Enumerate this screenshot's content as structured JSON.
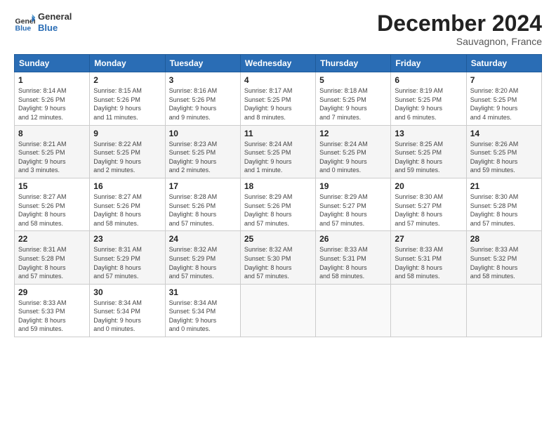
{
  "logo": {
    "line1": "General",
    "line2": "Blue"
  },
  "title": "December 2024",
  "subtitle": "Sauvagnon, France",
  "days_of_week": [
    "Sunday",
    "Monday",
    "Tuesday",
    "Wednesday",
    "Thursday",
    "Friday",
    "Saturday"
  ],
  "weeks": [
    [
      {
        "day": 1,
        "info": "Sunrise: 8:14 AM\nSunset: 5:26 PM\nDaylight: 9 hours\nand 12 minutes."
      },
      {
        "day": 2,
        "info": "Sunrise: 8:15 AM\nSunset: 5:26 PM\nDaylight: 9 hours\nand 11 minutes."
      },
      {
        "day": 3,
        "info": "Sunrise: 8:16 AM\nSunset: 5:26 PM\nDaylight: 9 hours\nand 9 minutes."
      },
      {
        "day": 4,
        "info": "Sunrise: 8:17 AM\nSunset: 5:25 PM\nDaylight: 9 hours\nand 8 minutes."
      },
      {
        "day": 5,
        "info": "Sunrise: 8:18 AM\nSunset: 5:25 PM\nDaylight: 9 hours\nand 7 minutes."
      },
      {
        "day": 6,
        "info": "Sunrise: 8:19 AM\nSunset: 5:25 PM\nDaylight: 9 hours\nand 6 minutes."
      },
      {
        "day": 7,
        "info": "Sunrise: 8:20 AM\nSunset: 5:25 PM\nDaylight: 9 hours\nand 4 minutes."
      }
    ],
    [
      {
        "day": 8,
        "info": "Sunrise: 8:21 AM\nSunset: 5:25 PM\nDaylight: 9 hours\nand 3 minutes."
      },
      {
        "day": 9,
        "info": "Sunrise: 8:22 AM\nSunset: 5:25 PM\nDaylight: 9 hours\nand 2 minutes."
      },
      {
        "day": 10,
        "info": "Sunrise: 8:23 AM\nSunset: 5:25 PM\nDaylight: 9 hours\nand 2 minutes."
      },
      {
        "day": 11,
        "info": "Sunrise: 8:24 AM\nSunset: 5:25 PM\nDaylight: 9 hours\nand 1 minute."
      },
      {
        "day": 12,
        "info": "Sunrise: 8:24 AM\nSunset: 5:25 PM\nDaylight: 9 hours\nand 0 minutes."
      },
      {
        "day": 13,
        "info": "Sunrise: 8:25 AM\nSunset: 5:25 PM\nDaylight: 8 hours\nand 59 minutes."
      },
      {
        "day": 14,
        "info": "Sunrise: 8:26 AM\nSunset: 5:25 PM\nDaylight: 8 hours\nand 59 minutes."
      }
    ],
    [
      {
        "day": 15,
        "info": "Sunrise: 8:27 AM\nSunset: 5:26 PM\nDaylight: 8 hours\nand 58 minutes."
      },
      {
        "day": 16,
        "info": "Sunrise: 8:27 AM\nSunset: 5:26 PM\nDaylight: 8 hours\nand 58 minutes."
      },
      {
        "day": 17,
        "info": "Sunrise: 8:28 AM\nSunset: 5:26 PM\nDaylight: 8 hours\nand 57 minutes."
      },
      {
        "day": 18,
        "info": "Sunrise: 8:29 AM\nSunset: 5:26 PM\nDaylight: 8 hours\nand 57 minutes."
      },
      {
        "day": 19,
        "info": "Sunrise: 8:29 AM\nSunset: 5:27 PM\nDaylight: 8 hours\nand 57 minutes."
      },
      {
        "day": 20,
        "info": "Sunrise: 8:30 AM\nSunset: 5:27 PM\nDaylight: 8 hours\nand 57 minutes."
      },
      {
        "day": 21,
        "info": "Sunrise: 8:30 AM\nSunset: 5:28 PM\nDaylight: 8 hours\nand 57 minutes."
      }
    ],
    [
      {
        "day": 22,
        "info": "Sunrise: 8:31 AM\nSunset: 5:28 PM\nDaylight: 8 hours\nand 57 minutes."
      },
      {
        "day": 23,
        "info": "Sunrise: 8:31 AM\nSunset: 5:29 PM\nDaylight: 8 hours\nand 57 minutes."
      },
      {
        "day": 24,
        "info": "Sunrise: 8:32 AM\nSunset: 5:29 PM\nDaylight: 8 hours\nand 57 minutes."
      },
      {
        "day": 25,
        "info": "Sunrise: 8:32 AM\nSunset: 5:30 PM\nDaylight: 8 hours\nand 57 minutes."
      },
      {
        "day": 26,
        "info": "Sunrise: 8:33 AM\nSunset: 5:31 PM\nDaylight: 8 hours\nand 58 minutes."
      },
      {
        "day": 27,
        "info": "Sunrise: 8:33 AM\nSunset: 5:31 PM\nDaylight: 8 hours\nand 58 minutes."
      },
      {
        "day": 28,
        "info": "Sunrise: 8:33 AM\nSunset: 5:32 PM\nDaylight: 8 hours\nand 58 minutes."
      }
    ],
    [
      {
        "day": 29,
        "info": "Sunrise: 8:33 AM\nSunset: 5:33 PM\nDaylight: 8 hours\nand 59 minutes."
      },
      {
        "day": 30,
        "info": "Sunrise: 8:34 AM\nSunset: 5:34 PM\nDaylight: 9 hours\nand 0 minutes."
      },
      {
        "day": 31,
        "info": "Sunrise: 8:34 AM\nSunset: 5:34 PM\nDaylight: 9 hours\nand 0 minutes."
      },
      null,
      null,
      null,
      null
    ]
  ]
}
